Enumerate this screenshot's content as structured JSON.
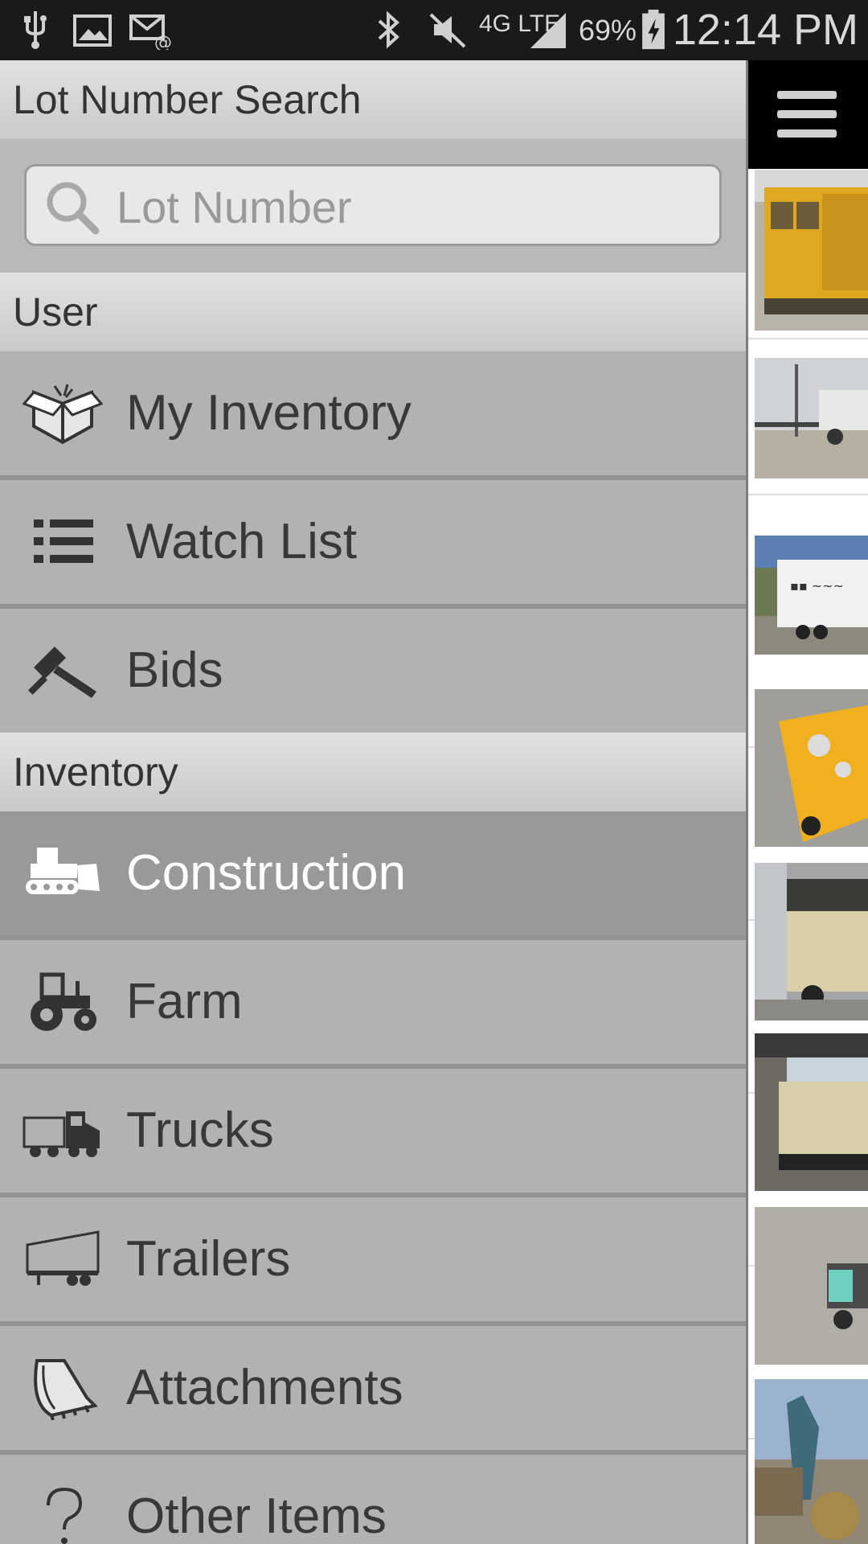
{
  "status_bar": {
    "battery": "69%",
    "network": "4G LTE",
    "time": "12:14 PM",
    "icons": [
      "usb-icon",
      "image-icon",
      "email-icon",
      "bluetooth-icon",
      "mute-icon",
      "network-4g-icon",
      "signal-icon",
      "battery-charging-icon"
    ]
  },
  "drawer": {
    "lot_search": {
      "header": "Lot Number Search",
      "placeholder": "Lot Number",
      "value": ""
    },
    "user_section": {
      "header": "User",
      "items": [
        {
          "label": "My Inventory",
          "icon": "box-icon"
        },
        {
          "label": "Watch List",
          "icon": "list-icon"
        },
        {
          "label": "Bids",
          "icon": "gavel-icon"
        }
      ]
    },
    "inventory_section": {
      "header": "Inventory",
      "items": [
        {
          "label": "Construction",
          "icon": "bulldozer-icon",
          "selected": true
        },
        {
          "label": "Farm",
          "icon": "tractor-icon"
        },
        {
          "label": "Trucks",
          "icon": "truck-icon"
        },
        {
          "label": "Trailers",
          "icon": "trailer-icon"
        },
        {
          "label": "Attachments",
          "icon": "bucket-icon"
        },
        {
          "label": "Other Items",
          "icon": "question-icon"
        }
      ]
    }
  },
  "colors": {
    "drawer_bg": "#b2b2b2",
    "selected_item_bg": "#999999",
    "header_bg": "#d6d6d6",
    "status_bar_bg": "#1a1a1a"
  },
  "listing_thumbnails": [
    "yellow-generator-thumbnail",
    "light-tower-trailer-thumbnail",
    "white-box-trailer-thumbnail",
    "yellow-generator-top-thumbnail",
    "beige-generator-thumbnail",
    "enclosed-generator-thumbnail",
    "small-generator-thumbnail",
    "equipment-yard-thumbnail"
  ]
}
